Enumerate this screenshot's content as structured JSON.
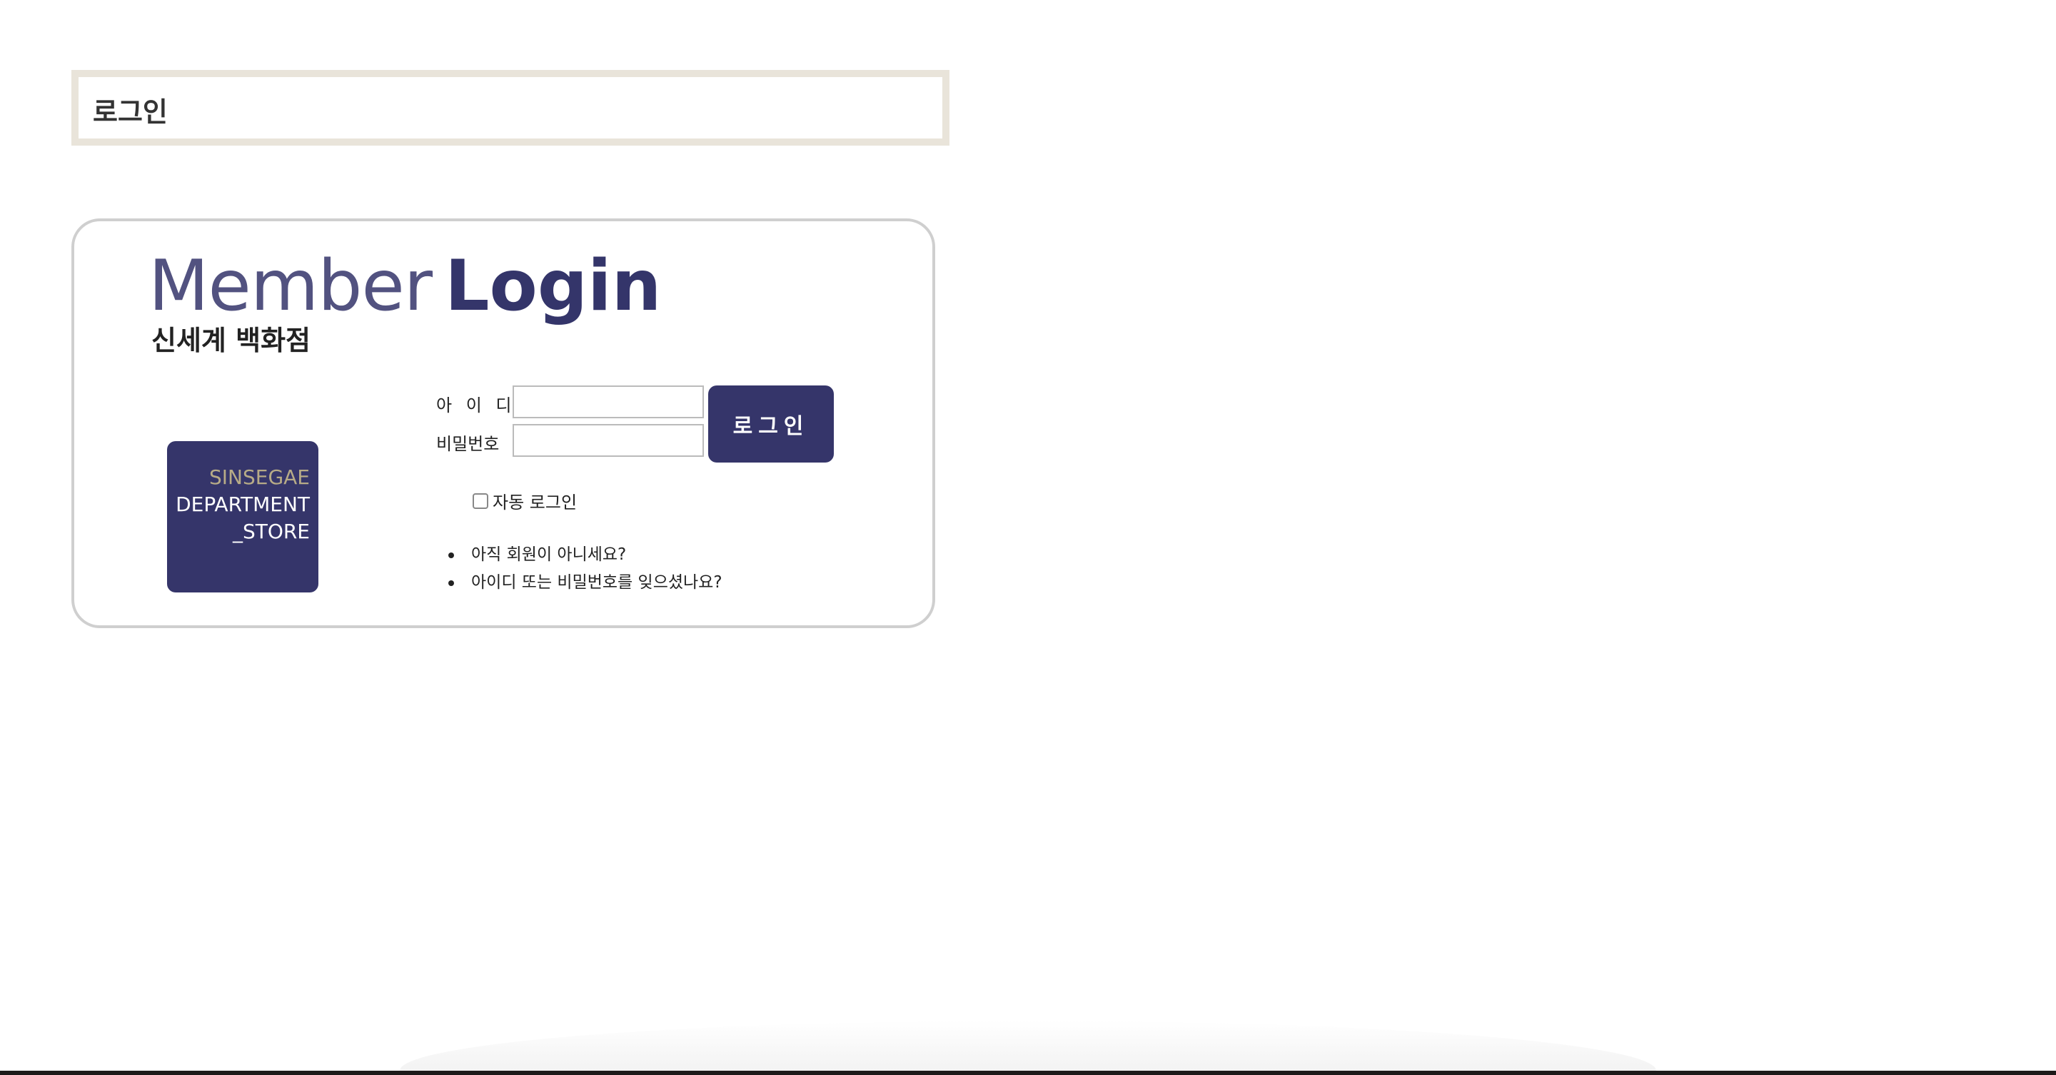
{
  "header": {
    "title": "로그인"
  },
  "login_panel": {
    "heading_thin": "Member",
    "heading_bold": "Login",
    "subtitle": "신세계 백화점",
    "logo": {
      "line1": "SINSEGAE",
      "line2": "DEPARTMENT",
      "line3": "_STORE"
    },
    "form": {
      "id_label": "아 이 디",
      "id_value": "",
      "password_label": "비밀번호",
      "password_value": "",
      "login_button_label": "로그인",
      "auto_login_label": "자동 로그인",
      "auto_login_checked": false
    },
    "help_links": [
      "아직 회원이 아니세요?",
      "아이디 또는 비밀번호를 잊으셨나요?"
    ]
  },
  "colors": {
    "brand_navy": "#35356a",
    "logo_gold": "#b7ab87",
    "title_border": "#e9e4da",
    "panel_border": "#cfcfcf"
  }
}
